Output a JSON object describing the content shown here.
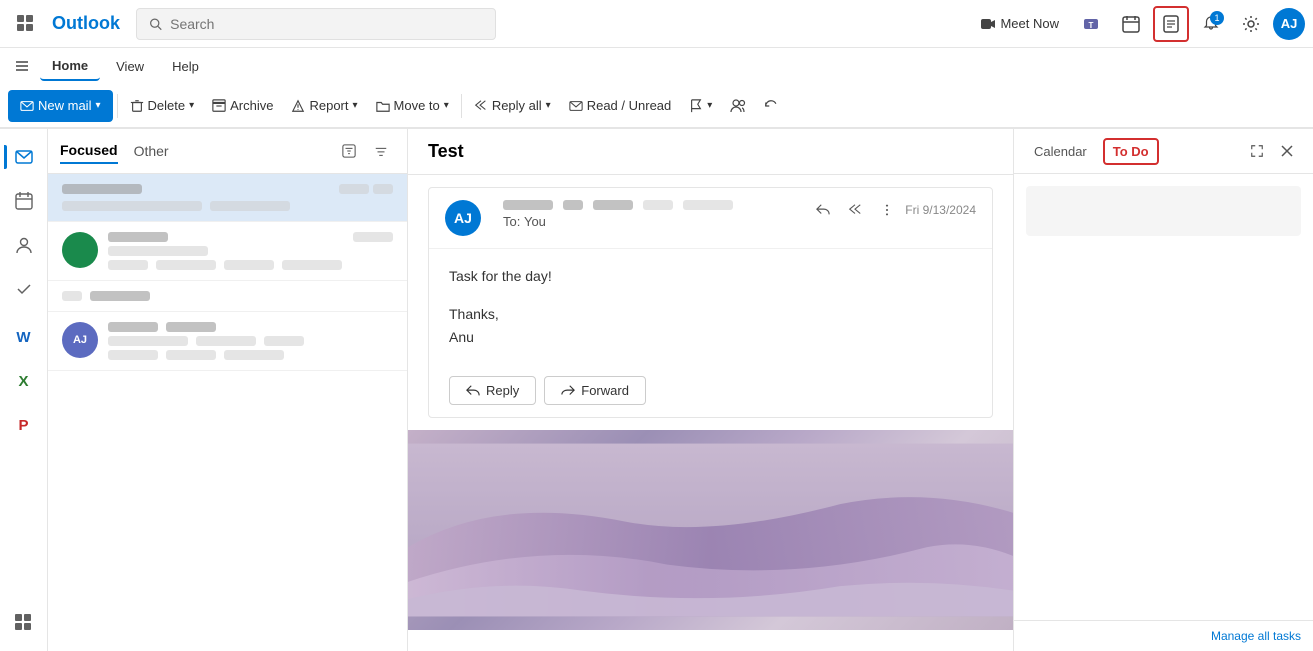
{
  "app": {
    "name": "Outlook",
    "grid_icon": "⊞",
    "search_placeholder": "Search"
  },
  "topbar": {
    "meet_now_label": "Meet Now",
    "notification_count": "1",
    "avatar_initials": "AJ"
  },
  "nav": {
    "tabs": [
      {
        "label": "Home",
        "active": true
      },
      {
        "label": "View",
        "active": false
      },
      {
        "label": "Help",
        "active": false
      }
    ]
  },
  "toolbar": {
    "new_mail_label": "New mail",
    "delete_label": "Delete",
    "archive_label": "Archive",
    "report_label": "Report",
    "move_to_label": "Move to",
    "reply_all_label": "Reply all",
    "read_unread_label": "Read / Unread"
  },
  "email_list": {
    "tabs": [
      {
        "label": "Focused",
        "active": true
      },
      {
        "label": "Other",
        "active": false
      }
    ],
    "items": [
      {
        "id": 1,
        "sender": "████ ████",
        "date": "██ ██",
        "subject": "████████ ███ ██████",
        "preview": "",
        "selected": true,
        "has_avatar": false,
        "avatar_color": ""
      },
      {
        "id": 2,
        "sender": "████ ████",
        "date": "",
        "subject": "███ ████",
        "preview": "████████ ███ ████████",
        "selected": false,
        "has_avatar": true,
        "avatar_initials": "",
        "avatar_color": "#1a8a4c"
      },
      {
        "id": 3,
        "sender": "██ ██████",
        "date": "",
        "subject": "",
        "preview": "",
        "selected": false,
        "has_avatar": false,
        "avatar_color": ""
      },
      {
        "id": 4,
        "sender": "████ ████",
        "date": "",
        "subject": "██████ ████",
        "preview": "███████ ███ ████████ ███ ██",
        "selected": false,
        "has_avatar": true,
        "avatar_initials": "AJ",
        "avatar_color": "#5c6bc0"
      }
    ]
  },
  "email_pane": {
    "title": "Test",
    "message": {
      "avatar_initials": "AJ",
      "avatar_color": "#0078d4",
      "from_blur": true,
      "to": "To:",
      "to_name": "You",
      "date": "Fri 9/13/2024",
      "body_line1": "Task for the day!",
      "body_line2": "",
      "sign_line1": "Thanks,",
      "sign_line2": "Anu",
      "reply_label": "Reply",
      "forward_label": "Forward"
    }
  },
  "right_panel": {
    "calendar_tab": "Calendar",
    "todo_tab": "To Do",
    "manage_tasks_label": "Manage all tasks"
  }
}
